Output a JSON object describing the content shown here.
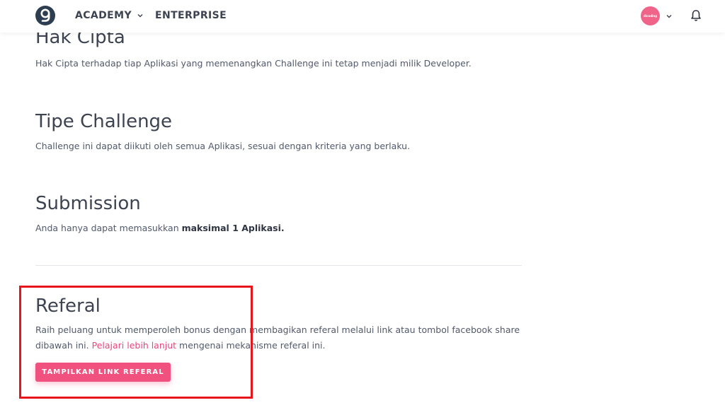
{
  "header": {
    "nav": [
      "ACADEMY",
      "ENTERPRISE"
    ],
    "avatar_text": "dicoding",
    "brand_color": "#f0517f"
  },
  "sections": {
    "hak_cipta": {
      "title": "Hak Cipta",
      "text": "Hak Cipta terhadap tiap Aplikasi yang memenangkan Challenge ini tetap menjadi milik Developer."
    },
    "tipe_challenge": {
      "title": "Tipe Challenge",
      "text": "Challenge ini dapat diikuti oleh semua Aplikasi, sesuai dengan kriteria yang berlaku."
    },
    "submission": {
      "title": "Submission",
      "text_prefix": "Anda hanya dapat memasukkan ",
      "text_bold": "maksimal 1 Aplikasi."
    },
    "referal": {
      "title": "Referal",
      "text_part1": "Raih peluang untuk memperoleh bonus dengan membagikan referal melalui link atau tombol facebook share dibawah ini. ",
      "link": "Pelajari lebih lanjut",
      "text_part2": " mengenai mekanisme referal ini.",
      "button": "TAMPILKAN LINK REFERAL"
    }
  }
}
